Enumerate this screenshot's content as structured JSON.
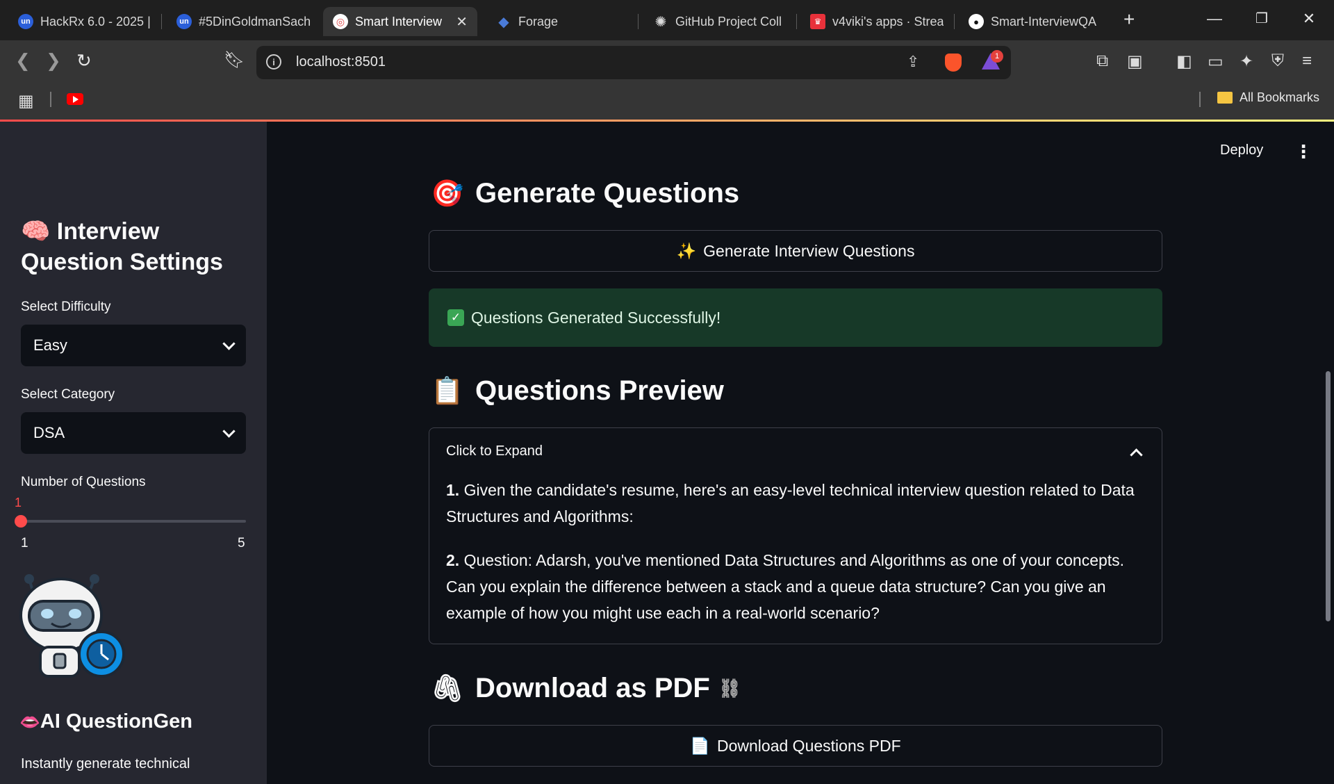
{
  "browser": {
    "tabs": [
      {
        "label": "HackRx 6.0 - 2025 |",
        "favicon": "unstop-icon",
        "active": false
      },
      {
        "label": "#5DinGoldmanSach",
        "favicon": "unstop-icon",
        "active": false
      },
      {
        "label": "Smart Interview",
        "favicon": "target-icon",
        "active": true
      },
      {
        "label": "Forage",
        "favicon": "forage-icon",
        "active": false
      },
      {
        "label": "GitHub Project Coll",
        "favicon": "openai-icon",
        "active": false
      },
      {
        "label": "v4viki's apps · Strea",
        "favicon": "streamlit-icon",
        "active": false
      },
      {
        "label": "Smart-InterviewQA",
        "favicon": "github-icon",
        "active": false
      }
    ],
    "url": "localhost:8501",
    "rewards_badge": "1",
    "bookmarks_label": "All Bookmarks"
  },
  "app": {
    "deploy_label": "Deploy",
    "sidebar": {
      "title_emoji": "🧠",
      "title": "Interview Question Settings",
      "difficulty_label": "Select Difficulty",
      "difficulty_value": "Easy",
      "category_label": "Select Category",
      "category_value": "DSA",
      "num_questions_label": "Number of Questions",
      "num_questions_value": "1",
      "num_questions_min": "1",
      "num_questions_max": "5",
      "brand_emoji": "👄",
      "brand": "AI QuestionGen",
      "description": "Instantly generate technical"
    },
    "main": {
      "generate_heading_emoji": "🎯",
      "generate_heading": "Generate Questions",
      "generate_button_emoji": "✨",
      "generate_button": "Generate Interview Questions",
      "success_message": "Questions Generated Successfully!",
      "preview_heading_emoji": "📋",
      "preview_heading": "Questions Preview",
      "expander_label": "Click to Expand",
      "questions": [
        {
          "num": "1.",
          "text": "Given the candidate's resume, here's an easy-level technical interview question related to Data Structures and Algorithms:"
        },
        {
          "num": "2.",
          "text": "Question: Adarsh, you've mentioned Data Structures and Algorithms as one of your concepts. Can you explain the difference between a stack and a queue data structure? Can you give an example of how you might use each in a real-world scenario?"
        }
      ],
      "download_heading_emoji": "🖇",
      "download_heading": "Download as PDF",
      "download_button_emoji": "📄",
      "download_button": "Download Questions PDF"
    }
  },
  "colors": {
    "accent": "#ff4b4b",
    "background": "#0e1117",
    "sidebar": "#262730",
    "success_bg": "#173928"
  }
}
